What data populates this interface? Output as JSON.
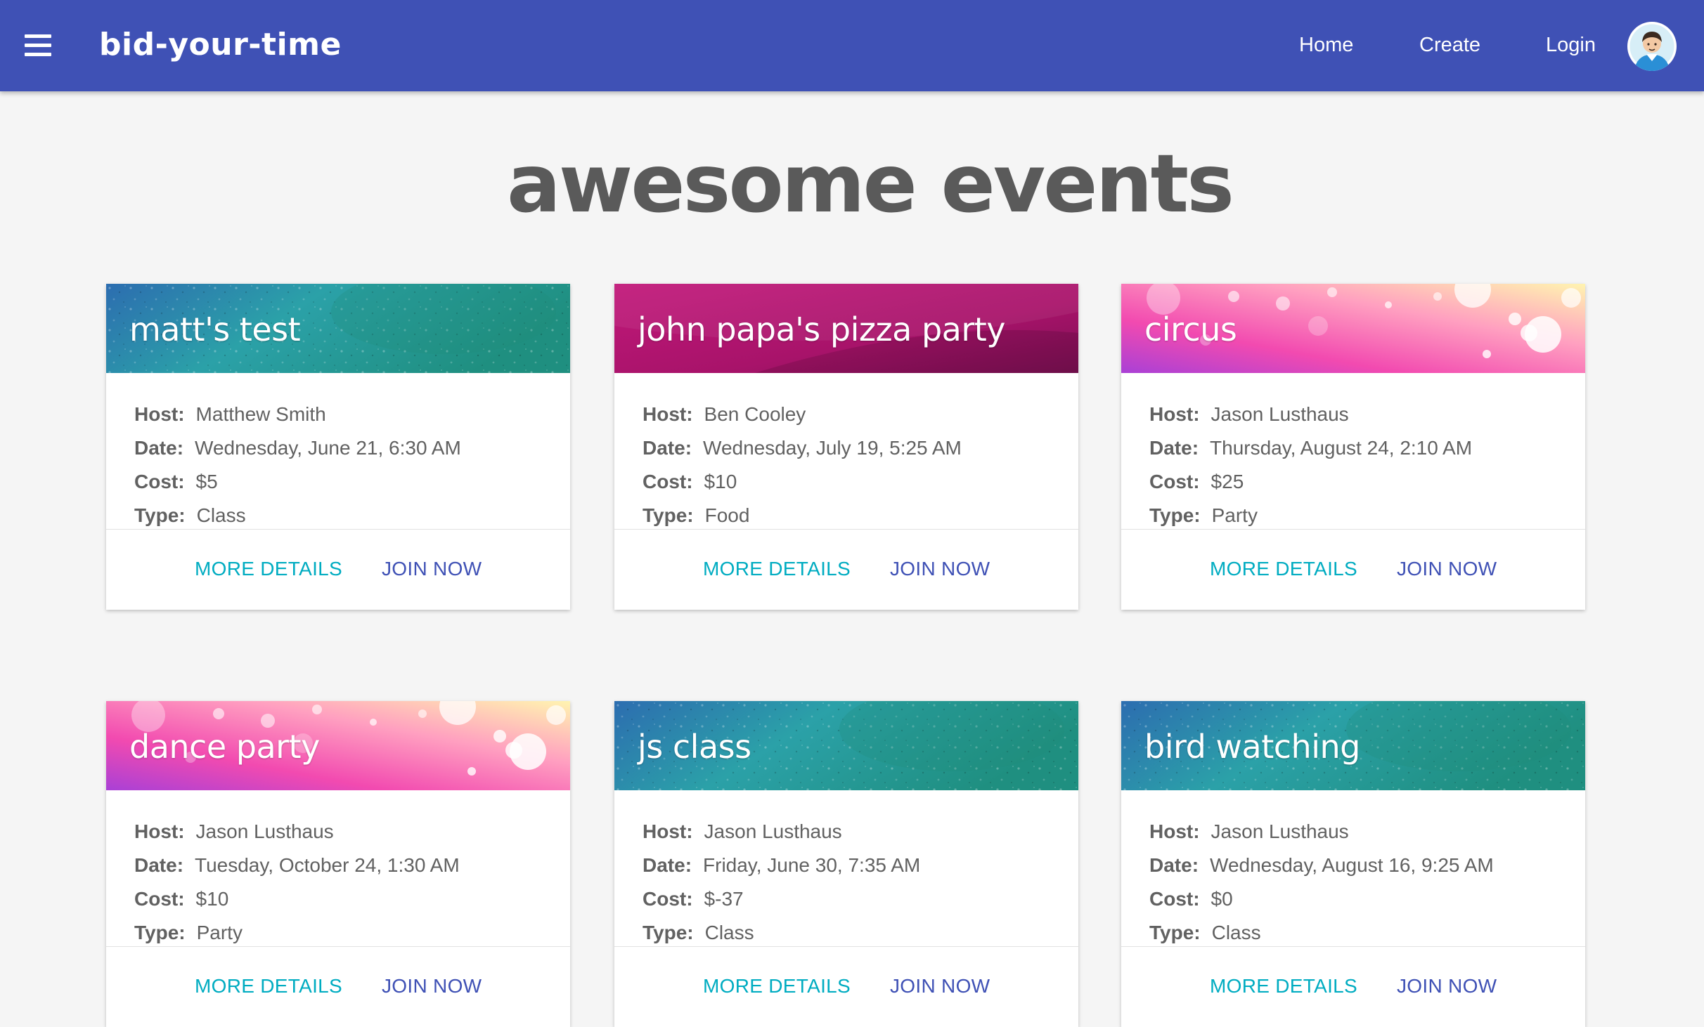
{
  "header": {
    "brand": "bid-your-time",
    "nav": [
      "Home",
      "Create",
      "Login"
    ]
  },
  "page_title": "awesome events",
  "labels": {
    "host": "Host:",
    "date": "Date:",
    "cost": "Cost:",
    "type": "Type:",
    "more_details": "MORE DETAILS",
    "join_now": "JOIN NOW"
  },
  "colors": {
    "toolbar": "#3f51b5",
    "more_details": "#00acc1",
    "join_now": "#3f51b5",
    "title": "#5a5a5a"
  },
  "events": [
    {
      "title": "matt's test",
      "host": "Matthew Smith",
      "date": "Wednesday, June 21, 6:30 AM",
      "cost": "$5",
      "type": "Class",
      "banner": "texture-blue"
    },
    {
      "title": "john papa's pizza party",
      "host": "Ben Cooley",
      "date": "Wednesday, July 19, 5:25 AM",
      "cost": "$10",
      "type": "Food",
      "banner": "magenta"
    },
    {
      "title": "circus",
      "host": "Jason Lusthaus",
      "date": "Thursday, August 24, 2:10 AM",
      "cost": "$25",
      "type": "Party",
      "banner": "bokeh-pink"
    },
    {
      "title": "dance party",
      "host": "Jason Lusthaus",
      "date": "Tuesday, October 24, 1:30 AM",
      "cost": "$10",
      "type": "Party",
      "banner": "bokeh-pink"
    },
    {
      "title": "js class",
      "host": "Jason Lusthaus",
      "date": "Friday, June 30, 7:35 AM",
      "cost": "$-37",
      "type": "Class",
      "banner": "texture-blue"
    },
    {
      "title": "bird watching",
      "host": "Jason Lusthaus",
      "date": "Wednesday, August 16, 9:25 AM",
      "cost": "$0",
      "type": "Class",
      "banner": "texture-blue"
    }
  ]
}
